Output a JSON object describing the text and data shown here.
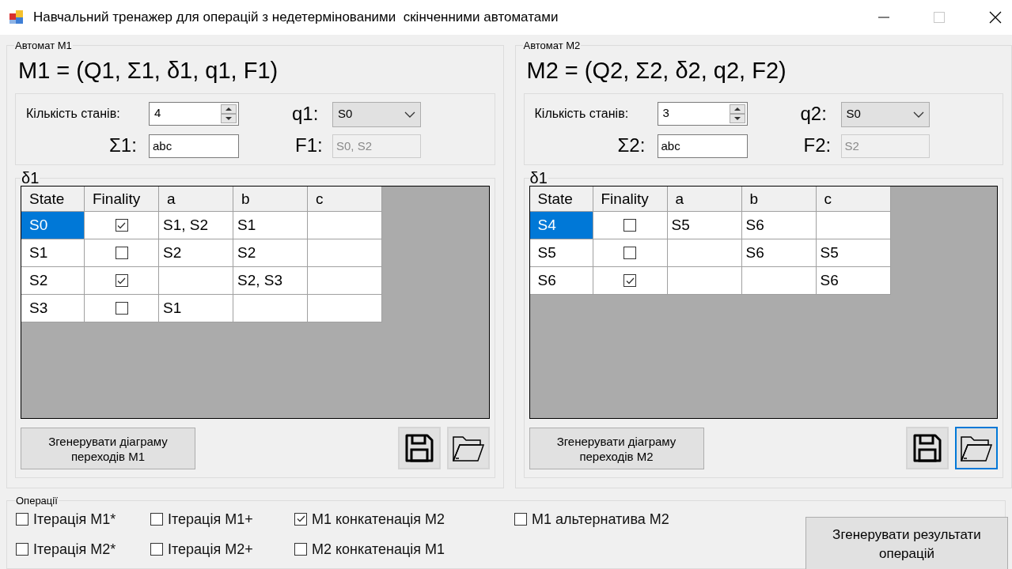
{
  "window": {
    "title": "Навчальний тренажер для операцій з недетермінованими  скінченними автоматами"
  },
  "automata": [
    {
      "group_label": "Автомат M1",
      "formula": "M1 = (Q1, Σ1, δ1, q1, F1)",
      "state_count": {
        "label": "Кількість станів:",
        "value": "4"
      },
      "alphabet": {
        "label": "Σ1:",
        "value": "abc"
      },
      "initial": {
        "label": "q1:",
        "value": "S0"
      },
      "final": {
        "label": "F1:",
        "value": "S0, S2",
        "disabled": true
      },
      "table": {
        "label": "δ1",
        "columns": [
          "State",
          "Finality",
          "a",
          "b",
          "c"
        ],
        "rows": [
          {
            "state": "S0",
            "selected": true,
            "final": true,
            "on_a": "S1, S2",
            "on_b": "S1"
          },
          {
            "state": "S1",
            "selected": false,
            "final": false,
            "on_a": "S2",
            "on_b": "S2"
          },
          {
            "state": "S2",
            "selected": false,
            "final": true,
            "on_b": "S2, S3"
          },
          {
            "state": "S3",
            "selected": false,
            "final": false,
            "on_a": "S1"
          }
        ]
      },
      "diagram_button": "Згенерувати діаграму переходів M1",
      "save_focused": false,
      "open_focused": false
    },
    {
      "group_label": "Автомат M2",
      "formula": "M2 = (Q2, Σ2, δ2, q2, F2)",
      "state_count": {
        "label": "Кількість станів:",
        "value": "3"
      },
      "alphabet": {
        "label": "Σ2:",
        "value": "abc"
      },
      "initial": {
        "label": "q2:",
        "value": "S0"
      },
      "final": {
        "label": "F2:",
        "value": "S2",
        "disabled": true
      },
      "table": {
        "label": "δ1",
        "columns": [
          "State",
          "Finality",
          "a",
          "b",
          "c"
        ],
        "rows": [
          {
            "state": "S4",
            "selected": true,
            "final": false,
            "on_a": "S5",
            "on_b": "S6"
          },
          {
            "state": "S5",
            "selected": false,
            "final": false,
            "on_b": "S6",
            "on_c": "S5"
          },
          {
            "state": "S6",
            "selected": false,
            "final": true,
            "on_c": "S6"
          }
        ]
      },
      "diagram_button": "Згенерувати діаграму переходів M2",
      "save_focused": false,
      "open_focused": true
    }
  ],
  "operations": {
    "label": "Операції",
    "options": [
      {
        "label": "Ітерація M1*",
        "checked": false
      },
      {
        "label": "Ітерація M1+",
        "checked": false
      },
      {
        "label": "M1 конкатенація M2",
        "checked": true
      },
      {
        "label": "M1 альтернатива M2",
        "checked": false
      },
      {
        "label": "Ітерація M2*",
        "checked": false
      },
      {
        "label": "Ітерація M2+",
        "checked": false
      },
      {
        "label": "M2 конкатенація M1",
        "checked": false
      }
    ],
    "run_button": "Згенерувати результати операцій"
  }
}
